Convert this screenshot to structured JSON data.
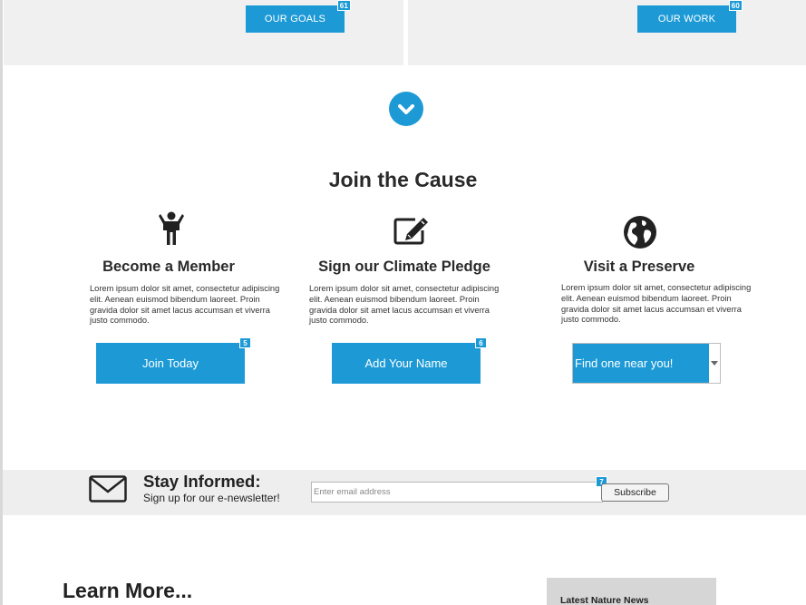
{
  "top_panels": [
    {
      "button_label": "OUR GOALS",
      "badge": "61"
    },
    {
      "button_label": "OUR WORK",
      "badge": "60"
    }
  ],
  "join": {
    "title": "Join the Cause",
    "columns": [
      {
        "icon": "person-icon",
        "title": "Become a Member",
        "body": "Lorem ipsum dolor sit amet, consectetur adipiscing elit. Aenean euismod bibendum laoreet. Proin gravida dolor sit amet lacus accumsan et viverra justo commodo.",
        "button_label": "Join Today",
        "badge": "5"
      },
      {
        "icon": "edit-pencil-icon",
        "title": "Sign our Climate Pledge",
        "body": "Lorem ipsum dolor sit amet, consectetur adipiscing elit. Aenean euismod bibendum laoreet. Proin gravida dolor sit amet lacus accumsan et viverra justo commodo.",
        "button_label": "Add Your Name",
        "badge": "6"
      },
      {
        "icon": "globe-icon",
        "title": "Visit a Preserve",
        "body": "Lorem ipsum dolor sit amet, consectetur adipiscing elit. Aenean euismod bibendum laoreet. Proin gravida dolor sit amet lacus accumsan et viverra justo commodo.",
        "select_value": "Find one near you!"
      }
    ]
  },
  "newsletter": {
    "title": "Stay Informed:",
    "subtitle": "Sign up for our e-newsletter!",
    "email_placeholder": "Enter email address",
    "badge": "7",
    "subscribe_label": "Subscribe"
  },
  "learn_more": {
    "title": "Learn More...",
    "news_panel_title": "Latest Nature News"
  },
  "colors": {
    "accent": "#1d9ad6",
    "panel_bg": "#f0f0f0",
    "text": "#222222"
  }
}
